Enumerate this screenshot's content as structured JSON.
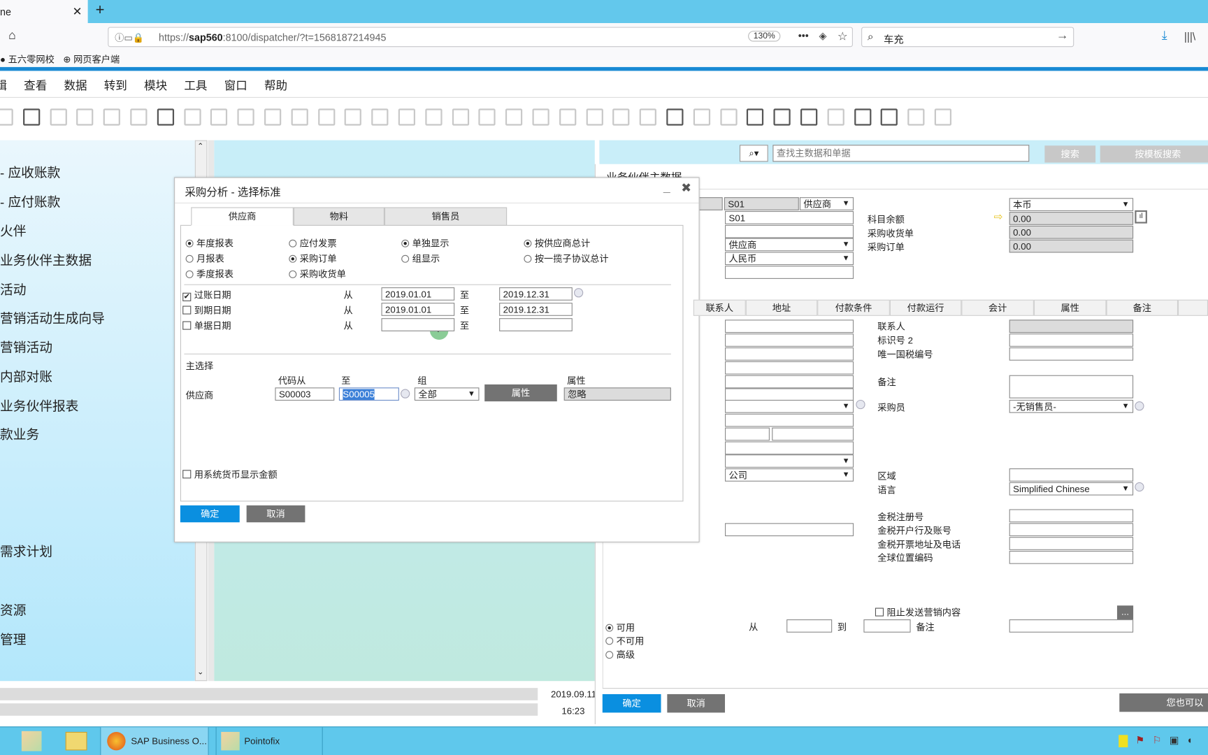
{
  "browser": {
    "tab_title": "ne",
    "new_tab": "+",
    "tab_close": "✕",
    "url_prefix": "https://",
    "url_host": "sap560",
    "url_rest": ":8100/dispatcher/?t=1568187214945",
    "zoom": "130%",
    "more": "•••",
    "search_value": "车充",
    "bookmarks": [
      {
        "label": "五六零网校"
      },
      {
        "label": "网页客户端"
      }
    ]
  },
  "menu": {
    "items": [
      "辑",
      "查看",
      "数据",
      "转到",
      "模块",
      "工具",
      "窗口",
      "帮助"
    ]
  },
  "toolbar": {
    "icons": [
      "chat-icon",
      "print-preview-icon",
      "excel-icon",
      "word-icon",
      "pdf-icon",
      "move-icon",
      "lock-layout-icon",
      "find-icon",
      "add-row-icon",
      "first-record-icon",
      "previous-record-icon",
      "next-record-icon",
      "last-record-icon",
      "refresh-icon",
      "filter-icon",
      "sort-icon",
      "base-document-icon",
      "target-document-icon",
      "gross-profit-icon",
      "payment-icon",
      "balance-icon",
      "journal-icon",
      "drill-icon",
      "edit-icon",
      "settings-icon",
      "form-settings-icon",
      "message-icon",
      "message-reply-icon",
      "approval-icon",
      "alert-icon",
      "calendar-icon",
      "org-icon",
      "user-icon",
      "help-icon",
      "tag-icon",
      "exit-icon"
    ]
  },
  "sidebar": {
    "items": [
      "- 应收账款",
      "- 应付账款",
      "火伴",
      "业务伙伴主数据",
      "活动",
      "营销活动生成向导",
      "营销活动",
      "内部对账",
      "业务伙伴报表",
      "款业务",
      "需求计划",
      "资源",
      "管理"
    ]
  },
  "status": {
    "date": "2019.09.11",
    "time": "16:23"
  },
  "global_search": {
    "placeholder": "查找主数据和单据",
    "search_label": "搜索",
    "template_search_label": "按模板搜索",
    "icon": "search-icon"
  },
  "bp_window": {
    "title": "业务伙伴主数据",
    "code": "S01",
    "type": "供应商",
    "name": "S01",
    "group": "供应商",
    "currency": "人民币",
    "balance_currency": "本币",
    "balances": [
      {
        "label": "科目余额",
        "value": "0.00"
      },
      {
        "label": "采购收货单",
        "value": "0.00"
      },
      {
        "label": "采购订单",
        "value": "0.00"
      }
    ],
    "tabs": [
      "联系人",
      "地址",
      "付款条件",
      "付款运行",
      "会计",
      "属性",
      "备注"
    ],
    "general_labels": {
      "contact": "联系人",
      "id2": "标识号 2",
      "tax_id": "唯一国税编号",
      "remarks": "备注",
      "buyer": "采购员",
      "territory": "区域",
      "language": "语言",
      "gt_reg": "金税注册号",
      "gt_bank": "金税开户行及账号",
      "gt_addr": "金税开票地址及电话",
      "gln": "全球位置编码"
    },
    "buyer_value": "-无销售员-",
    "language_value": "Simplified Chinese",
    "company_value": "公司",
    "block_marketing": "阻止发送营销内容",
    "more_btn": "...",
    "status_options": [
      {
        "label": "可用",
        "selected": true
      },
      {
        "label": "不可用",
        "selected": false
      },
      {
        "label": "高级",
        "selected": false
      }
    ],
    "from": "从",
    "to": "到",
    "remarks": "备注",
    "ok": "确定",
    "cancel": "取消",
    "you_can": "您也可以"
  },
  "dialog": {
    "title": "采购分析 - 选择标准",
    "tabs": [
      {
        "label": "供应商",
        "active": true
      },
      {
        "label": "物料",
        "active": false
      },
      {
        "label": "销售员",
        "active": false
      }
    ],
    "radios": {
      "period": [
        {
          "label": "年度报表",
          "selected": true
        },
        {
          "label": "月报表",
          "selected": false
        },
        {
          "label": "季度报表",
          "selected": false
        }
      ],
      "doc": [
        {
          "label": "应付发票",
          "selected": false
        },
        {
          "label": "采购订单",
          "selected": true
        },
        {
          "label": "采购收货单",
          "selected": false
        }
      ],
      "display": [
        {
          "label": "单独显示",
          "selected": true
        },
        {
          "label": "组显示",
          "selected": false
        }
      ],
      "total": [
        {
          "label": "按供应商总计",
          "selected": true
        },
        {
          "label": "按一揽子协议总计",
          "selected": false
        }
      ]
    },
    "dates": [
      {
        "label": "过账日期",
        "checked": true,
        "from_label": "从",
        "from": "2019.01.01",
        "to_label": "至",
        "to": "2019.12.31"
      },
      {
        "label": "到期日期",
        "checked": false,
        "from_label": "从",
        "from": "2019.01.01",
        "to_label": "至",
        "to": "2019.12.31"
      },
      {
        "label": "单据日期",
        "checked": false,
        "from_label": "从",
        "from": "",
        "to_label": "至",
        "to": ""
      }
    ],
    "main_selection": {
      "title": "主选择",
      "col_code_from": "代码从",
      "col_to": "至",
      "col_group": "组",
      "col_props": "属性",
      "row_label": "供应商",
      "code_from": "S00003",
      "code_to": "S00005",
      "group": "全部",
      "props_button": "属性",
      "props_value": "忽略"
    },
    "sys_currency": {
      "label": "用系统货币显示金额",
      "checked": false
    },
    "ok": "确定",
    "cancel": "取消"
  },
  "taskbar": {
    "items": [
      {
        "label": "SAP Business O...",
        "active": true
      },
      {
        "label": "Pointofix",
        "active": false
      }
    ]
  },
  "colors": {
    "accent": "#0a8fe0",
    "browser_chrome": "#63c8ec",
    "taskbar": "#5fc8ec",
    "button_gray": "#737373"
  }
}
